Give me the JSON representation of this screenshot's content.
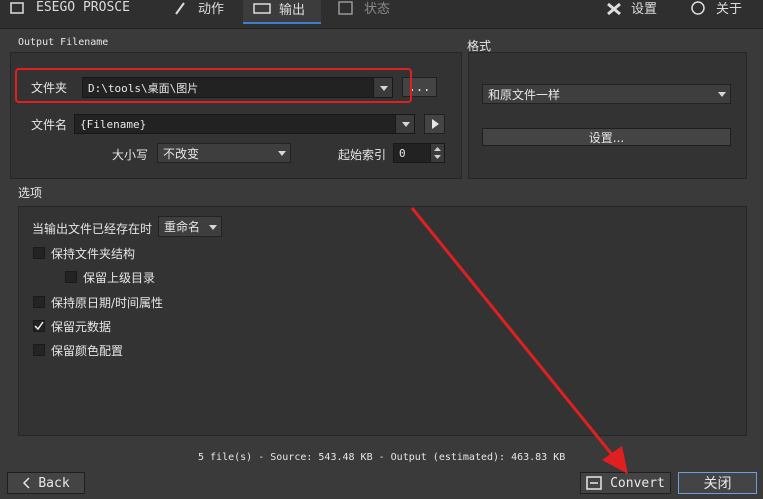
{
  "tabs": [
    {
      "label": "ESEGO PROSCE"
    },
    {
      "label": "动作"
    },
    {
      "label": "输出"
    },
    {
      "label": "状态"
    }
  ],
  "top_right": {
    "settings": "设置",
    "about": "关于"
  },
  "output_filename": {
    "group_title": "Output Filename",
    "folder_label": "文件夹",
    "folder_value": "D:\\tools\\桌面\\图片",
    "browse_label": "...",
    "filename_label": "文件名",
    "filename_value": "{Filename}",
    "case_label": "大小写",
    "case_value": "不改变",
    "start_index_label": "起始索引",
    "start_index_value": "0"
  },
  "format": {
    "group_title": "格式",
    "format_value": "和原文件一样",
    "settings_button": "设置..."
  },
  "options": {
    "group_title": "选项",
    "if_exists_label": "当输出文件已经存在时",
    "if_exists_value": "重命名",
    "items": [
      {
        "label": "保持文件夹结构",
        "checked": false
      },
      {
        "label": "保留上级目录",
        "checked": false
      },
      {
        "label": "保持原日期/时间属性",
        "checked": false
      },
      {
        "label": "保留元数据",
        "checked": true
      },
      {
        "label": "保留颜色配置",
        "checked": false
      }
    ]
  },
  "status_text": "5 file(s) - Source: 543.48 KB - Output (estimated): 463.83 KB",
  "buttons": {
    "back": "Back",
    "convert": "Convert",
    "close": "关闭"
  },
  "colors": {
    "accent": "#3a7fd0",
    "highlight": "#e02020",
    "background": "#3a3a3a"
  }
}
